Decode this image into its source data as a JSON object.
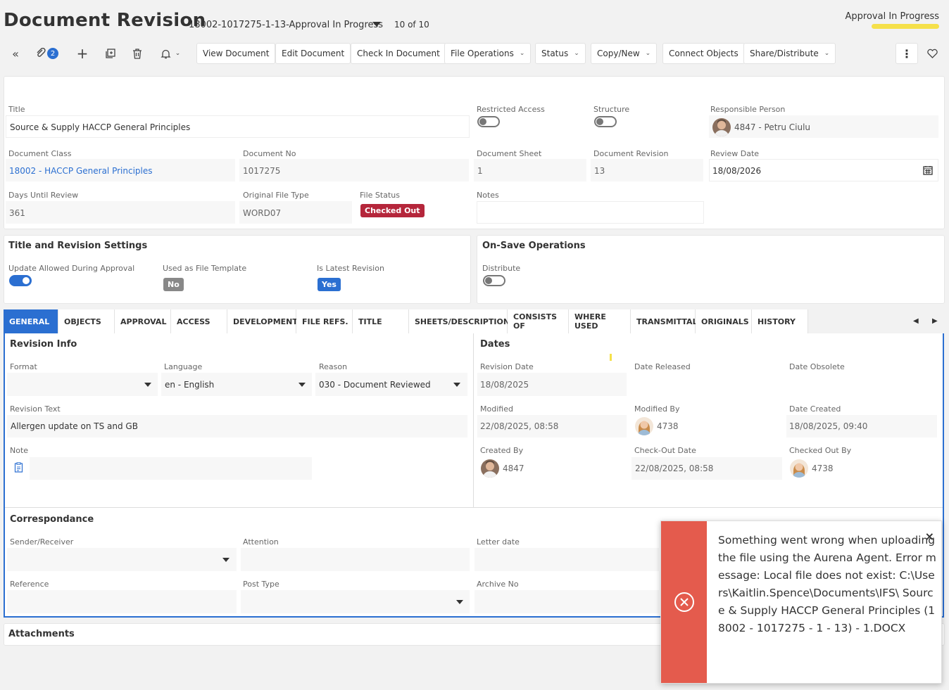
{
  "header": {
    "title": "Document Revision",
    "record_key": "18002-1017275-1-13-Approval In Progress",
    "record_count": "10 of 10",
    "status": "Approval In Progress",
    "status_color": "#f5e04a"
  },
  "toolbar": {
    "attachment_count": "2",
    "buttons": [
      "View Document",
      "Edit Document",
      "Check In Document",
      "File Operations",
      "Status",
      "Copy/New",
      "Connect Objects",
      "Share/Distribute"
    ]
  },
  "details": {
    "title_label": "Title",
    "title_value": "Source & Supply HACCP General Principles",
    "restricted_label": "Restricted Access",
    "structure_label": "Structure",
    "responsible_label": "Responsible Person",
    "responsible_value": "4847 - Petru Ciulu",
    "doc_class_label": "Document Class",
    "doc_class_value": "18002 - HACCP General Principles",
    "doc_no_label": "Document No",
    "doc_no_value": "1017275",
    "doc_sheet_label": "Document Sheet",
    "doc_sheet_value": "1",
    "doc_rev_label": "Document Revision",
    "doc_rev_value": "13",
    "review_date_label": "Review Date",
    "review_date_value": "18/08/2026",
    "days_label": "Days Until Review",
    "days_value": "361",
    "orig_type_label": "Original File Type",
    "orig_type_value": "WORD07",
    "file_status_label": "File Status",
    "file_status_value": "Checked Out",
    "file_status_color": "#b5263b",
    "notes_label": "Notes"
  },
  "title_rev": {
    "heading": "Title and Revision Settings",
    "update_label": "Update Allowed During Approval",
    "template_label": "Used as File Template",
    "template_value": "No",
    "latest_label": "Is Latest Revision",
    "latest_value": "Yes"
  },
  "on_save": {
    "heading": "On-Save Operations",
    "distribute_label": "Distribute"
  },
  "tabs": [
    "GENERAL",
    "OBJECTS",
    "APPROVAL",
    "ACCESS",
    "DEVELOPMENT",
    "FILE REFS.",
    "TITLE",
    "SHEETS/DESCRIPTIONS",
    "CONSISTS OF",
    "WHERE USED",
    "TRANSMITTAL",
    "ORIGINALS",
    "HISTORY"
  ],
  "revision_info": {
    "heading": "Revision Info",
    "format_label": "Format",
    "language_label": "Language",
    "language_value": "en - English",
    "reason_label": "Reason",
    "reason_value": "030 - Document Reviewed",
    "rev_text_label": "Revision Text",
    "rev_text_value": "Allergen update on TS and GB",
    "note_label": "Note"
  },
  "dates": {
    "heading": "Dates",
    "rev_date_label": "Revision Date",
    "rev_date_value": "18/08/2025",
    "released_label": "Date Released",
    "obsolete_label": "Date Obsolete",
    "modified_label": "Modified",
    "modified_value": "22/08/2025, 08:58",
    "modified_by_label": "Modified By",
    "modified_by_value": "4738",
    "created_label": "Date Created",
    "created_value": "18/08/2025, 09:40",
    "created_by_label": "Created By",
    "created_by_value": "4847",
    "checkout_label": "Check-Out Date",
    "checkout_value": "22/08/2025, 08:58",
    "checked_by_label": "Checked Out By",
    "checked_by_value": "4738"
  },
  "correspondance": {
    "heading": "Correspondance",
    "sender_label": "Sender/Receiver",
    "attention_label": "Attention",
    "letter_label": "Letter date",
    "reference_label": "Reference",
    "post_label": "Post Type",
    "archive_label": "Archive No"
  },
  "attachments": {
    "heading": "Attachments"
  },
  "toast": {
    "message": "Something went wrong when uploading the file using the Aurena Agent. Error message: Local file does not exist: C:\\Users\\Kaitlin.Spence\\Documents\\IFS\\ Source & Supply HACCP General Principles (18002 - 1017275 - 1 - 13) - 1.DOCX",
    "color": "#e45b4d"
  }
}
